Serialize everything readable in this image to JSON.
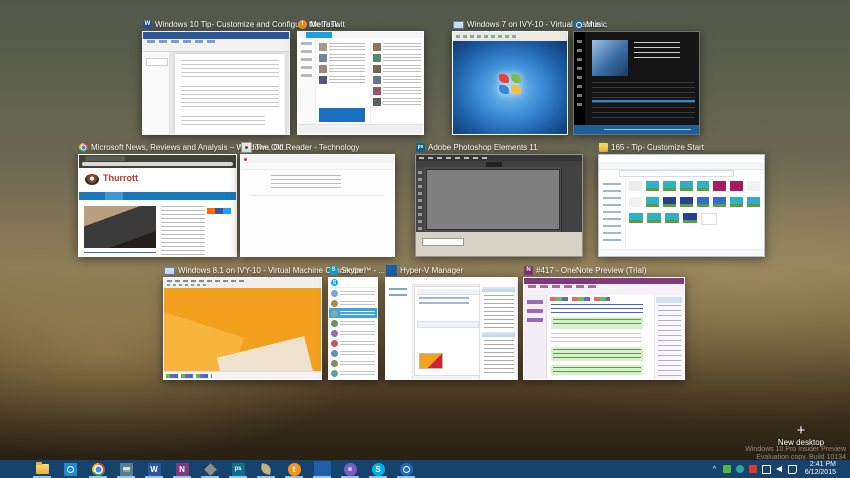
{
  "task_view": {
    "windows": [
      {
        "title": "Windows 10 Tip- Customize and Configure the Task...",
        "app": "Microsoft Word",
        "icon": "word-icon"
      },
      {
        "title": "MetroTwit",
        "app": "MetroTwit",
        "icon": "metrotwit-icon"
      },
      {
        "title": "Windows 7 on IVY-10 - Virtual Machin...",
        "app": "Virtual Machine Connection",
        "icon": "vm-monitor-icon"
      },
      {
        "title": "Music",
        "app": "Music",
        "icon": "music-icon"
      },
      {
        "title": "Microsoft News, Reviews and Analysis – Windows, Of...",
        "app": "Google Chrome",
        "icon": "chrome-icon"
      },
      {
        "title": "The Old Reader - Technology",
        "app": "Browser",
        "icon": "oldreader-icon"
      },
      {
        "title": "Adobe Photoshop Elements 11",
        "app": "Photoshop Elements",
        "icon": "photoshop-elements-icon"
      },
      {
        "title": "165 - Tip- Customize Start",
        "app": "File Explorer",
        "icon": "folder-icon"
      },
      {
        "title": "Windows 8.1 on IVY-10 - Virtual Machine Connection",
        "app": "Virtual Machine Connection",
        "icon": "vm-monitor-icon"
      },
      {
        "title": "Skype™ ‑ ...",
        "app": "Skype",
        "icon": "skype-icon"
      },
      {
        "title": "Hyper-V Manager",
        "app": "Hyper-V Manager",
        "icon": "hyperv-icon"
      },
      {
        "title": "#417 - OneNote Preview (Trial)",
        "app": "OneNote",
        "icon": "onenote-icon"
      }
    ],
    "new_desktop_label": "New desktop"
  },
  "thumbnails": {
    "thurrott_logo": "Thurrott"
  },
  "watermark": {
    "line1": "Windows 10 Pro Insider Preview",
    "line2": "Evaluation copy. Build 10134"
  },
  "taskbar": {
    "icons": [
      "start",
      "file-explorer",
      "insider-app",
      "chrome",
      "photos",
      "word",
      "onenote",
      "photoshop-organizer",
      "photoshop-editor",
      "metrotwit-loop",
      "metrotwit",
      "hyper-v-manager",
      "media-app",
      "skype",
      "music"
    ],
    "tray_icons": [
      "tray-expand",
      "antivirus",
      "sync-app",
      "recorder",
      "display",
      "volume",
      "action-center"
    ],
    "clock": {
      "time": "2:41 PM",
      "date": "6/12/2015"
    }
  },
  "glyphs": {
    "word": "W",
    "onenote": "N",
    "skype": "S",
    "metrotwit": "t",
    "photoshop": "ps",
    "plus": "+",
    "tray_expand": "^"
  },
  "colors": {
    "taskbar": "#15436b",
    "taskbar_underline": "#8ec6f2",
    "word_accent": "#2b579a",
    "onenote_accent": "#80397b",
    "win81_wallpaper": "#f2a01e",
    "metrotwit_accent": "#1ba1e2"
  }
}
